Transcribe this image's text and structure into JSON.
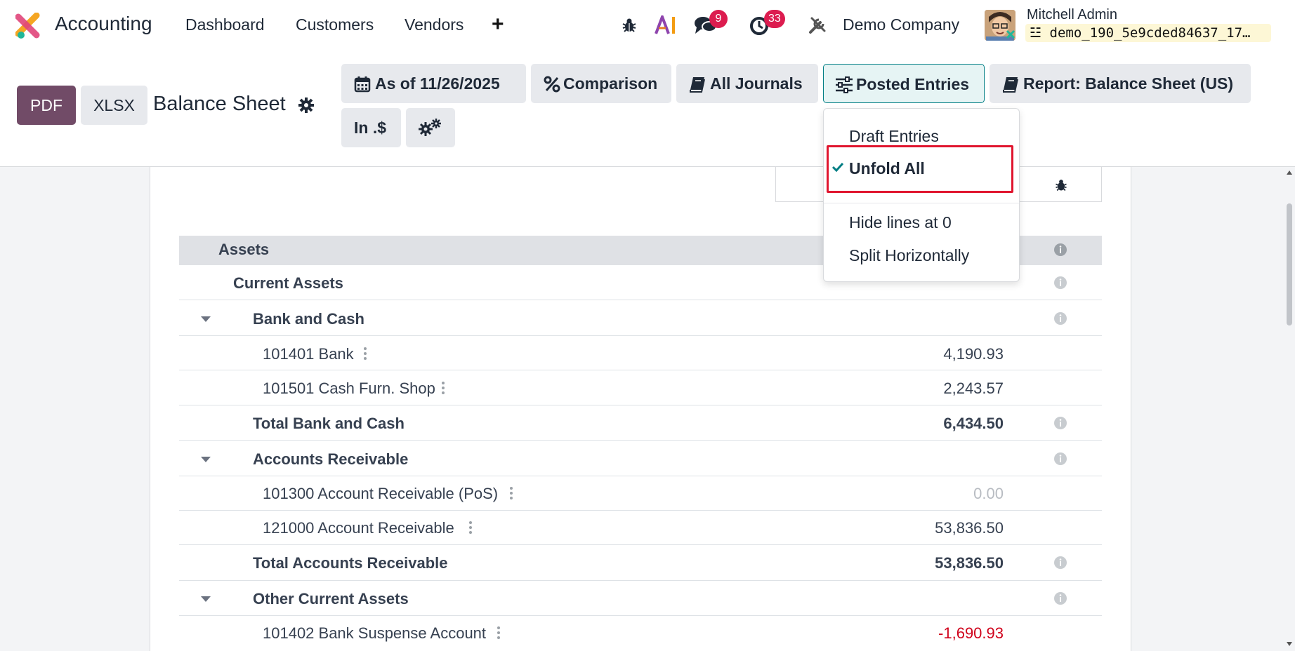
{
  "navbar": {
    "app_name": "Accounting",
    "links": [
      "Dashboard",
      "Customers",
      "Vendors"
    ],
    "messages_badge": "9",
    "activities_badge": "33",
    "company": "Demo Company",
    "user_name": "Mitchell Admin",
    "database": "demo_190_5e9cded84637_17…"
  },
  "control": {
    "pdf_label": "PDF",
    "xlsx_label": "XLSX",
    "title": "Balance Sheet",
    "filters": {
      "date": "As of 11/26/2025",
      "comparison": "Comparison",
      "journals": "All Journals",
      "entries": "Posted Entries",
      "report": "Report: Balance Sheet (US)",
      "currency": "In .$"
    }
  },
  "dropdown": {
    "items": [
      "Draft Entries",
      "Unfold All",
      "Hide lines at 0",
      "Split Horizontally"
    ],
    "checked_item": "Unfold All"
  },
  "rows": {
    "assets": "Assets",
    "current_assets": "Current Assets",
    "bank_cash": "Bank and Cash",
    "bank": {
      "label": "101401 Bank",
      "amount": "4,190.93"
    },
    "cash_shop": {
      "label": "101501 Cash Furn. Shop",
      "amount": "2,243.57"
    },
    "total_bank_cash": {
      "label": "Total Bank and Cash",
      "amount": "6,434.50"
    },
    "accounts_receivable": "Accounts Receivable",
    "ar_pos": {
      "label": "101300 Account Receivable (PoS)",
      "amount": "0.00"
    },
    "ar": {
      "label": "121000 Account Receivable",
      "amount": "53,836.50"
    },
    "total_ar": {
      "label": "Total Accounts Receivable",
      "amount": "53,836.50"
    },
    "other_current_assets": "Other Current Assets",
    "suspense": {
      "label": "101402 Bank Suspense Account",
      "amount": "-1,690.93"
    }
  },
  "colors": {
    "brand": "#714b67",
    "accent": "#017e84",
    "badge": "#dc1c4f",
    "negative": "#d0021b",
    "highlight": "#e0152e"
  }
}
